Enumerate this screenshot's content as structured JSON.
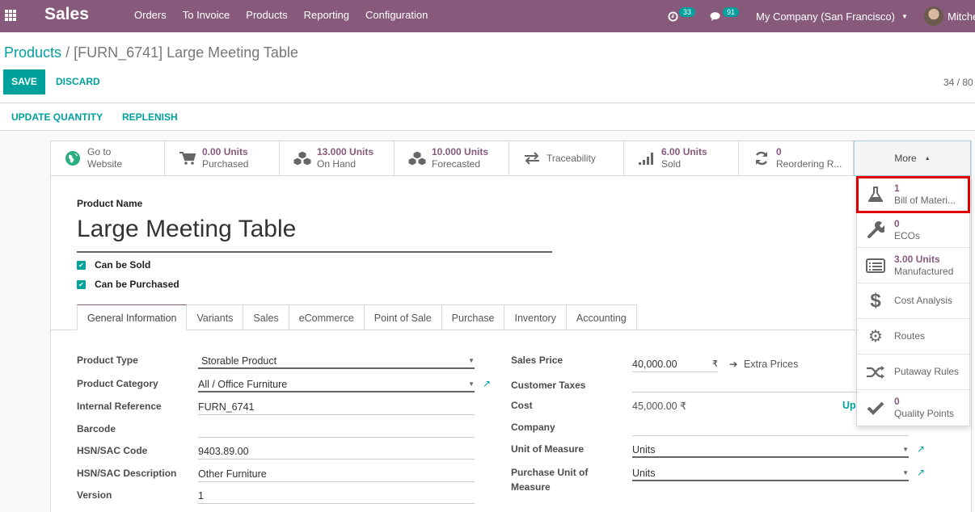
{
  "navbar": {
    "app_name": "Sales",
    "menu": [
      "Orders",
      "To Invoice",
      "Products",
      "Reporting",
      "Configuration"
    ],
    "activity_count": "33",
    "message_count": "91",
    "company": "My Company (San Francisco)",
    "user": "Mitche"
  },
  "breadcrumb": {
    "parent": "Products",
    "separator": "/",
    "current": "[FURN_6741] Large Meeting Table"
  },
  "actions": {
    "save": "SAVE",
    "discard": "DISCARD"
  },
  "pager": "34 / 80",
  "statusbar": {
    "update_qty": "UPDATE QUANTITY",
    "replenish": "REPLENISH"
  },
  "smart_buttons": [
    {
      "icon": "globe-icon",
      "value": "Go to",
      "label": "Website"
    },
    {
      "icon": "cart-icon",
      "value": "0.00 Units",
      "label": "Purchased"
    },
    {
      "icon": "cubes-icon",
      "value": "13.000 Units",
      "label": "On Hand"
    },
    {
      "icon": "cubes-icon",
      "value": "10.000 Units",
      "label": "Forecasted"
    },
    {
      "icon": "exchange-icon",
      "value": "",
      "label": "Traceability"
    },
    {
      "icon": "signal-icon",
      "value": "6.00 Units",
      "label": "Sold"
    },
    {
      "icon": "refresh-icon",
      "value": "0",
      "label": "Reordering R..."
    }
  ],
  "more": {
    "label": "More"
  },
  "more_dropdown": [
    {
      "icon": "flask-icon",
      "value": "1",
      "label": "Bill of Materi..."
    },
    {
      "icon": "wrench-icon",
      "value": "0",
      "label": "ECOs"
    },
    {
      "icon": "list-icon",
      "value": "3.00 Units",
      "label": "Manufactured"
    },
    {
      "icon": "dollar-icon",
      "value": "",
      "label": "Cost Analysis"
    },
    {
      "icon": "cogs-icon",
      "value": "",
      "label": "Routes"
    },
    {
      "icon": "random-icon",
      "value": "",
      "label": "Putaway Rules"
    },
    {
      "icon": "check-icon",
      "value": "0",
      "label": "Quality Points"
    }
  ],
  "product": {
    "name_label": "Product Name",
    "name": "Large Meeting Table",
    "can_be_sold": "Can be Sold",
    "can_be_purchased": "Can be Purchased"
  },
  "tabs": [
    "General Information",
    "Variants",
    "Sales",
    "eCommerce",
    "Point of Sale",
    "Purchase",
    "Inventory",
    "Accounting"
  ],
  "left_fields": {
    "product_type": {
      "label": "Product Type",
      "value": "Storable Product"
    },
    "product_category": {
      "label": "Product Category",
      "value": "All / Office Furniture"
    },
    "internal_reference": {
      "label": "Internal Reference",
      "value": "FURN_6741"
    },
    "barcode": {
      "label": "Barcode",
      "value": ""
    },
    "hsn_code": {
      "label": "HSN/SAC Code",
      "value": "9403.89.00"
    },
    "hsn_description": {
      "label": "HSN/SAC Description",
      "value": "Other Furniture"
    },
    "version": {
      "label": "Version",
      "value": "1"
    }
  },
  "right_fields": {
    "sales_price": {
      "label": "Sales Price",
      "value": "40,000.00",
      "currency": "₹",
      "extra": "Extra Prices"
    },
    "customer_taxes": {
      "label": "Customer Taxes",
      "value": ""
    },
    "cost": {
      "label": "Cost",
      "value": "45,000.00 ₹",
      "link": "Up"
    },
    "company": {
      "label": "Company",
      "value": ""
    },
    "uom": {
      "label": "Unit of Measure",
      "value": "Units"
    },
    "purchase_uom": {
      "label": "Purchase Unit of Measure",
      "value": "Units"
    }
  }
}
